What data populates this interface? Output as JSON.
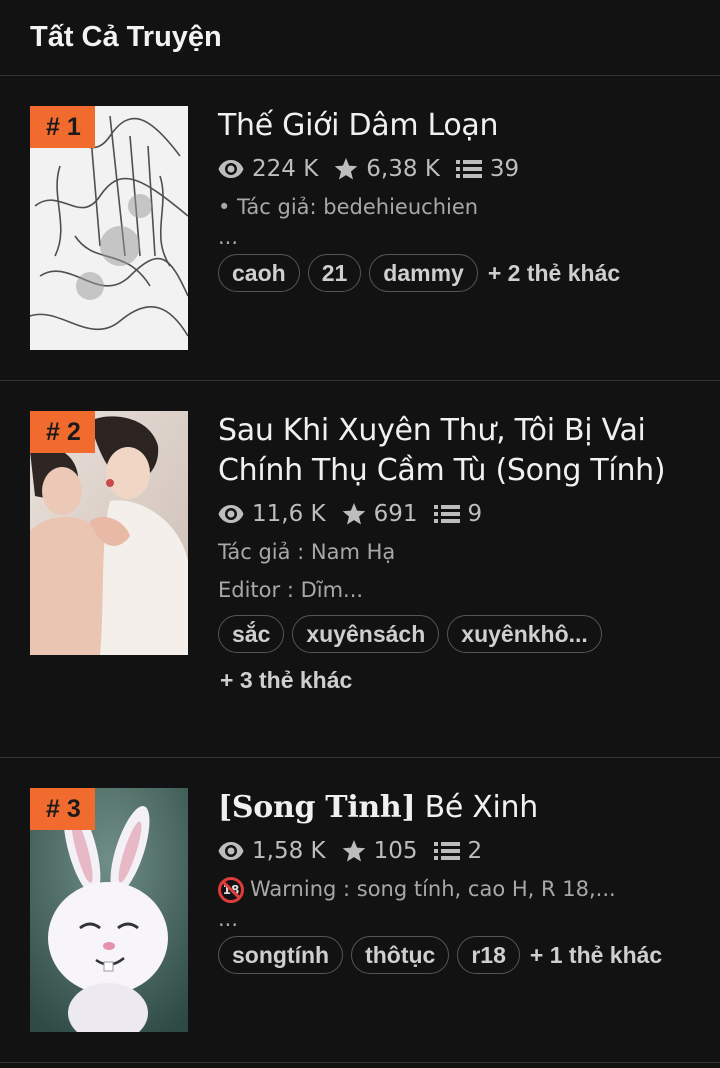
{
  "header": {
    "title": "Tất Cả Truyện"
  },
  "stories": [
    {
      "rank": "# 1",
      "title": "Thế Giới Dâm Loạn",
      "views": "224 K",
      "stars": "6,38 K",
      "chapters": "39",
      "desc": [
        "• Tác giả: bedehieuchien",
        "..."
      ],
      "tags": [
        "caoh",
        "21",
        "dammy"
      ],
      "more_tags": "+ 2 thẻ khác"
    },
    {
      "rank": "# 2",
      "title": "Sau Khi Xuyên Thư, Tôi Bị Vai Chính Thụ Cầm Tù (Song Tính)",
      "views": "11,6 K",
      "stars": "691",
      "chapters": "9",
      "desc": [
        "Tác giả : Nam Hạ",
        "Editor : Dĩm..."
      ],
      "tags": [
        "sắc",
        "xuyênsách",
        "xuyênkhô..."
      ],
      "more_tags": "+ 3 thẻ khác"
    },
    {
      "rank": "# 3",
      "title_prefix": "[Song Tinh]",
      "title_prefix_inner": "Song Tinh",
      "title": "Bé Xinh",
      "views": "1,58 K",
      "stars": "105",
      "chapters": "2",
      "warning_icon_text": "18",
      "desc": [
        "Warning : song tính, cao H, R 18,...",
        "..."
      ],
      "tags": [
        "songtính",
        "thôtục",
        "r18"
      ],
      "more_tags": "+ 1 thẻ khác"
    }
  ],
  "icons": {
    "views": "eye-icon",
    "stars": "star-icon",
    "chapters": "list-icon",
    "warning": "no-under-18-icon"
  },
  "colors": {
    "background": "#121212",
    "rank_badge": "#f26b2e",
    "divider": "#333333"
  }
}
